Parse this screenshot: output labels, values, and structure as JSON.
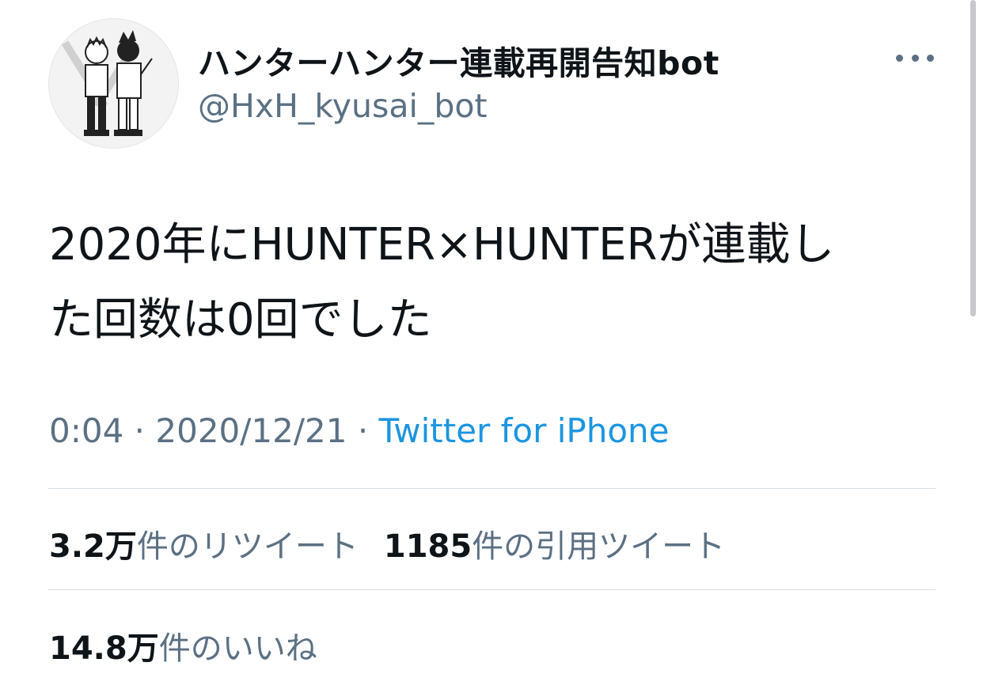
{
  "account": {
    "display_name": "ハンターハンター連載再開告知bot",
    "handle": "@HxH_kyusai_bot",
    "avatar_icon": "avatar-illustration"
  },
  "tweet": {
    "text_line1": "2020年にHUNTER×HUNTERが連載し",
    "text_line2": "た回数は0回でした",
    "time": "0:04",
    "separator": " · ",
    "date": "2020/12/21",
    "source": "Twitter for iPhone"
  },
  "stats": {
    "retweets_count": "3.2万",
    "retweets_label": "件のリツイート",
    "quotes_count": "1185",
    "quotes_label": "件の引用ツイート",
    "likes_count": "14.8万",
    "likes_label": "件のいいね"
  },
  "colors": {
    "text_primary": "#0f1419",
    "text_secondary": "#5b7083",
    "link": "#1b95e0",
    "divider": "#d9dfe4"
  }
}
